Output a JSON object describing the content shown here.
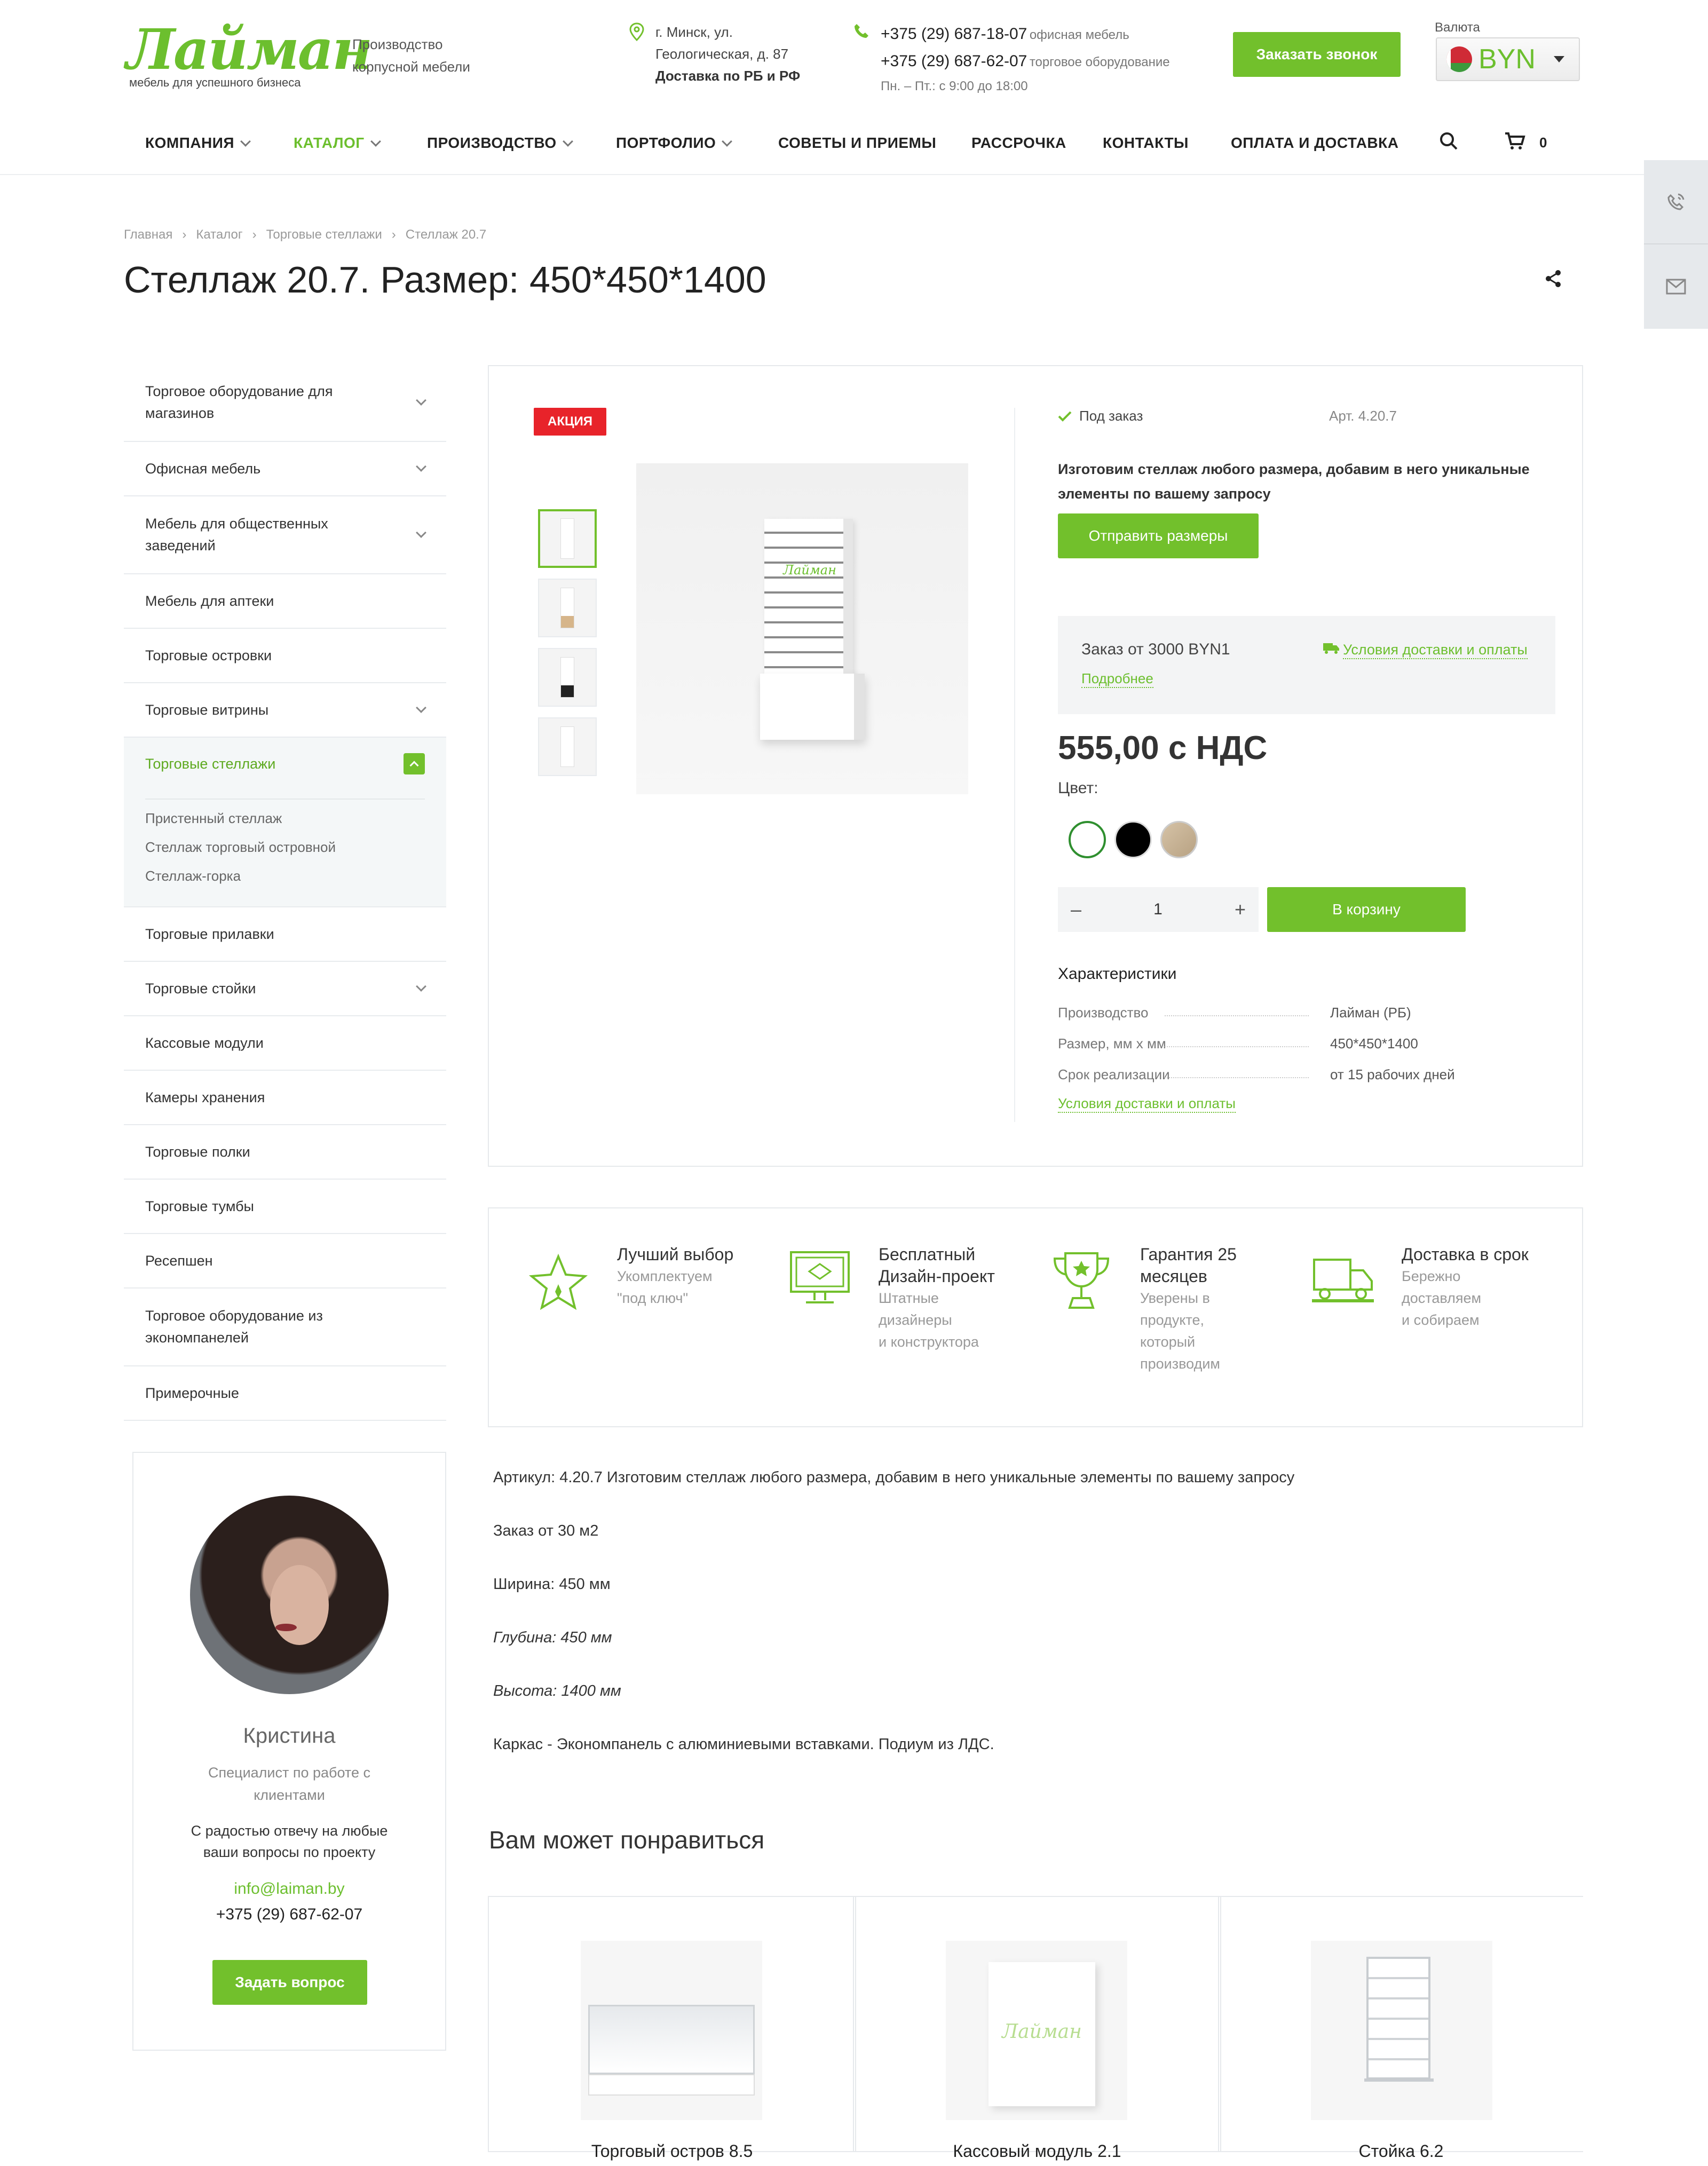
{
  "header": {
    "logo_text": "Лайман",
    "logo_tagline": "мебель для успешного бизнеса",
    "company_desc_1": "Производство",
    "company_desc_2": "корпусной мебели",
    "address_1": "г. Минск, ул.",
    "address_2": "Геологическая, д. 87",
    "delivery": "Доставка по РБ и РФ",
    "phone_1": "+375 (29) 687-18-07",
    "phone_1_label": "офисная мебель",
    "phone_2": "+375 (29) 687-62-07",
    "phone_2_label": "торговое оборудование",
    "hours": "Пн. – Пт.: с 9:00 до 18:00",
    "callback_button": "Заказать звонок",
    "currency_label": "Валюта",
    "currency": "BYN",
    "cart_count": "0"
  },
  "nav": [
    {
      "label": "КОМПАНИЯ"
    },
    {
      "label": "КАТАЛОГ"
    },
    {
      "label": "ПРОИЗВОДСТВО"
    },
    {
      "label": "ПОРТФОЛИО"
    },
    {
      "label": "СОВЕТЫ И ПРИЕМЫ"
    },
    {
      "label": "РАССРОЧКА"
    },
    {
      "label": "КОНТАКТЫ"
    },
    {
      "label": "ОПЛАТА И ДОСТАВКА"
    }
  ],
  "breadcrumb": [
    "Главная",
    "Каталог",
    "Торговые стеллажи",
    "Стеллаж 20.7"
  ],
  "page_title": "Стеллаж 20.7. Размер: 450*450*1400",
  "sidebar": {
    "items": [
      {
        "label": "Торговое оборудование для магазинов"
      },
      {
        "label": "Офисная мебель"
      },
      {
        "label": "Мебель для общественных заведений"
      },
      {
        "label": "Мебель для аптеки"
      },
      {
        "label": "Торговые островки"
      },
      {
        "label": "Торговые витрины"
      },
      {
        "label": "Торговые стеллажи"
      },
      {
        "label": "Торговые прилавки"
      },
      {
        "label": "Торговые стойки"
      },
      {
        "label": "Кассовые модули"
      },
      {
        "label": "Камеры хранения"
      },
      {
        "label": "Торговые полки"
      },
      {
        "label": "Торговые тумбы"
      },
      {
        "label": "Ресепшен"
      },
      {
        "label": "Торговое оборудование из экономпанелей"
      },
      {
        "label": "Примерочные"
      }
    ],
    "sub_items": [
      {
        "label": "Пристенный стеллаж"
      },
      {
        "label": "Стеллаж торговый островной"
      },
      {
        "label": "Стеллаж-горка"
      }
    ]
  },
  "product": {
    "badge": "АКЦИЯ",
    "availability": "Под заказ",
    "article": "Арт. 4.20.7",
    "custom_text": "Изготовим стеллаж любого размера, добавим в него уникальные элементы по вашему запросу",
    "send_sizes_button": "Отправить размеры",
    "min_order": "Заказ от 3000 BYN1",
    "more_link": "Подробнее",
    "delivery_link": "Условия доставки и оплаты",
    "price": "555,00 с НДС",
    "color_label": "Цвет:",
    "quantity": "1",
    "qty_minus": "–",
    "qty_plus": "+",
    "cart_button": "В корзину",
    "characteristics_title": "Характеристики",
    "characteristics": [
      {
        "key": "Производство",
        "value": "Лайман (РБ)"
      },
      {
        "key": "Размер, мм х мм",
        "value": "450*450*1400"
      },
      {
        "key": "Срок реализации",
        "value": "от 15 рабочих дней"
      }
    ],
    "characteristics_link": "Условия доставки и оплаты",
    "image_logo": "Лайман"
  },
  "features": [
    {
      "title": "Лучший выбор",
      "subtitle_1": "Укомплектуем",
      "subtitle_2": "\"под ключ\""
    },
    {
      "title_1": "Бесплатный",
      "title_2": "Дизайн-проект",
      "subtitle_1": "Штатные",
      "subtitle_2": "дизайнеры",
      "subtitle_3": "и конструктора"
    },
    {
      "title_1": "Гарантия 25",
      "title_2": "месяцев",
      "subtitle_1": "Уверены в",
      "subtitle_2": "продукте,",
      "subtitle_3": "который",
      "subtitle_4": "производим"
    },
    {
      "title": "Доставка в срок",
      "subtitle_1": "Бережно",
      "subtitle_2": "доставляем",
      "subtitle_3": "и собираем"
    }
  ],
  "manager": {
    "name": "Кристина",
    "role_1": "Специалист по работе с",
    "role_2": "клиентами",
    "text_1": "С радостью отвечу на любые",
    "text_2": "ваши вопросы по проекту",
    "email": "info@laiman.by",
    "phone": "+375 (29) 687-62-07",
    "button": "Задать вопрос"
  },
  "description": [
    "Артикул: 4.20.7 Изготовим стеллаж любого размера, добавим в него уникальные элементы по вашему запросу",
    "Заказ от 30 м2",
    "Ширина: 450 мм",
    "Глубина: 450 мм",
    "Высота: 1400 мм",
    "Каркас - Экономпанель с алюминиевыми вставками. Подиум из ЛДС."
  ],
  "related": {
    "title": "Вам может понравиться",
    "items": [
      {
        "title": "Торговый остров 8.5"
      },
      {
        "title": "Кассовый модуль 2.1",
        "image_logo": "Лайман"
      },
      {
        "title": "Стойка 6.2"
      }
    ]
  },
  "colors": {
    "accent": "#72c02c",
    "badge_red": "#e8232a",
    "swatch_black": "#000000",
    "swatch_wood": "#c8b59a"
  }
}
